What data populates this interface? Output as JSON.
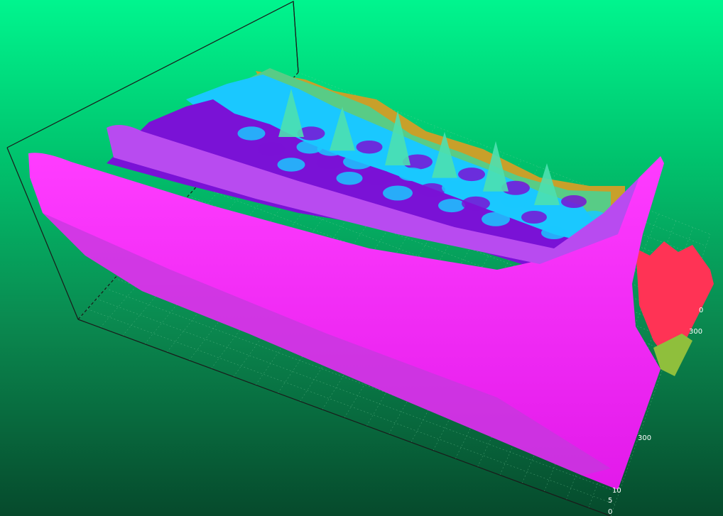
{
  "chart_data": {
    "type": "surface3d",
    "title": "",
    "xlabel": "",
    "ylabel": "",
    "zlabel": "",
    "axis_ticks": {
      "right_depth": [
        "0",
        "300"
      ],
      "front_edge": [
        "300",
        "10"
      ],
      "corner": [
        "5",
        "0"
      ]
    },
    "colormap": [
      "#ff1aff",
      "#b84bf0",
      "#7a12d6",
      "#1ac8ff",
      "#4de0b0",
      "#8fbf3c",
      "#c8a02a",
      "#ff3355"
    ],
    "background_gradient": [
      "#00f58e",
      "#064a2c"
    ],
    "wireframe_color": "#7fd0a0",
    "box_color": "#1a1a1a",
    "grid": true,
    "ridge_peaks": [
      {
        "x": 0.3,
        "h": 0.55
      },
      {
        "x": 0.42,
        "h": 0.45
      },
      {
        "x": 0.55,
        "h": 0.7
      },
      {
        "x": 0.66,
        "h": 0.5
      },
      {
        "x": 0.78,
        "h": 0.6
      },
      {
        "x": 0.9,
        "h": 0.4
      }
    ]
  }
}
